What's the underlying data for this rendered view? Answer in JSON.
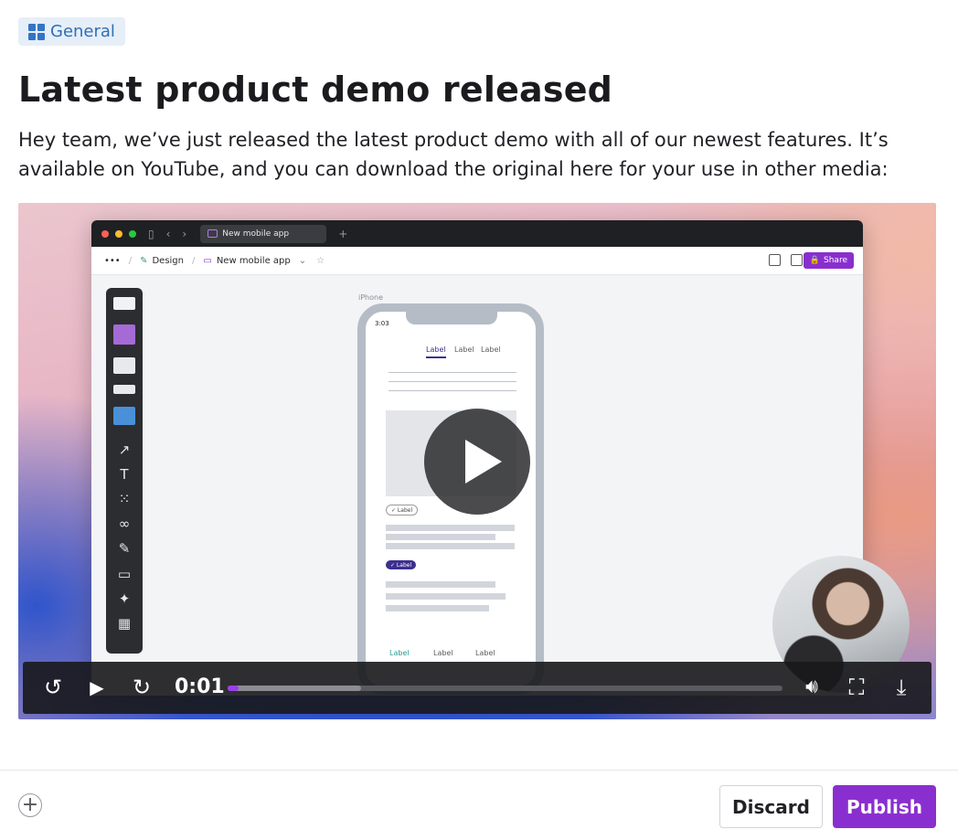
{
  "tag": {
    "label": "General",
    "icon": "grid-icon",
    "color": "#2f6fb8"
  },
  "post": {
    "title": "Latest product demo released",
    "body": "Hey team, we’ve just released the latest product demo with all of our newest features. It’s available on YouTube, and you can download the original here for your use in other media:"
  },
  "video": {
    "app_window": {
      "tab_title": "New mobile app",
      "breadcrumb": [
        "Design",
        "New mobile app"
      ],
      "share_label": "Share",
      "frame_label": "iPhone",
      "phone": {
        "time": "3:03",
        "tabs": [
          "Label",
          "Label",
          "Label"
        ],
        "chip_outline": "✓ Label",
        "chip_filled": "✓ Label",
        "nav": [
          "Label",
          "Label",
          "Label"
        ]
      }
    },
    "controls": {
      "time": "0:01",
      "progress": 0.02,
      "buffered": 0.24
    },
    "accent_color": "#9b3fe8"
  },
  "actions": {
    "discard": "Discard",
    "publish": "Publish",
    "publish_color": "#8a2fcf"
  }
}
